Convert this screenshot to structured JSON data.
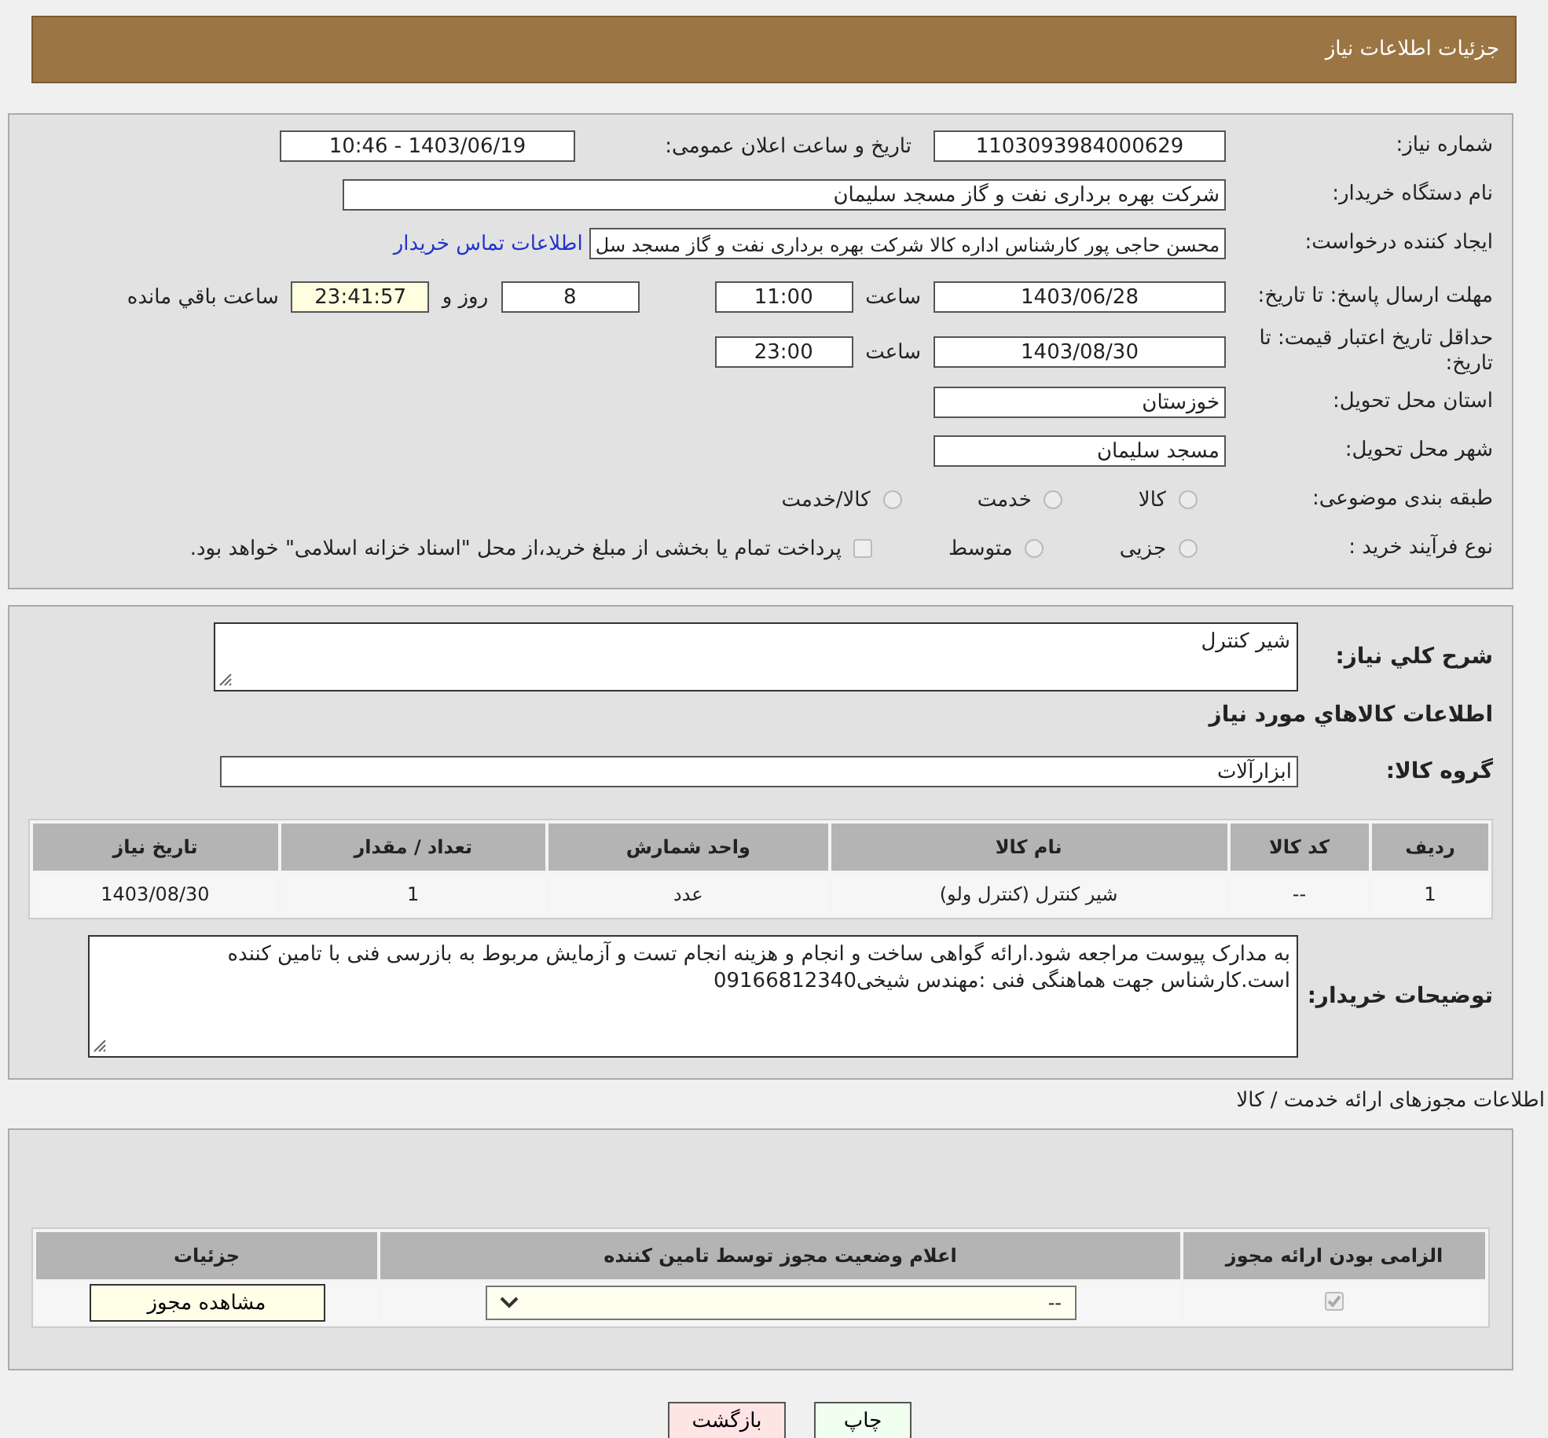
{
  "header": {
    "title": "جزئیات اطلاعات نیاز"
  },
  "need_number": {
    "label": "شماره نیاز:",
    "value": "1103093984000629"
  },
  "announce": {
    "label": "تاریخ و ساعت اعلان عمومی:",
    "value": "1403/06/19 - 10:46"
  },
  "buyer_org": {
    "label": "نام دستگاه خریدار:",
    "value": "شرکت بهره برداری نفت و گاز مسجد سلیمان"
  },
  "requester": {
    "label": "ایجاد کننده درخواست:",
    "value": "محسن حاجی پور کارشناس اداره کالا  شرکت بهره برداری نفت و گاز مسجد سل",
    "link": "اطلاعات تماس خریدار"
  },
  "reply_deadline": {
    "label": "مهلت ارسال پاسخ: تا تاریخ:",
    "date": "1403/06/28",
    "time_label": "ساعت",
    "time": "11:00",
    "days": "8",
    "days_label": "روز و",
    "remaining": "23:41:57",
    "remaining_label": "ساعت باقي مانده"
  },
  "price_validity": {
    "label": "حداقل تاریخ اعتبار قیمت: تا تاریخ:",
    "date": "1403/08/30",
    "time_label": "ساعت",
    "time": "23:00"
  },
  "province": {
    "label": "استان محل تحویل:",
    "value": "خوزستان"
  },
  "city": {
    "label": "شهر محل تحویل:",
    "value": "مسجد سلیمان"
  },
  "category": {
    "label": "طبقه بندی موضوعی:",
    "options": [
      {
        "label": "کالا",
        "selected": false
      },
      {
        "label": "خدمت",
        "selected": false
      },
      {
        "label": "کالا/خدمت",
        "selected": false
      }
    ]
  },
  "purchase_type": {
    "label": "نوع فرآیند خرید :",
    "options": [
      {
        "label": "جزیی",
        "selected": false
      },
      {
        "label": "متوسط",
        "selected": false
      }
    ],
    "payment_note": {
      "checked": false,
      "text": "پرداخت تمام یا بخشی از مبلغ خرید،از محل \"اسناد خزانه اسلامی\" خواهد بود."
    }
  },
  "description": {
    "label": "شرح کلي نياز:",
    "value": "شیر کنترل"
  },
  "goods_title": "اطلاعات کالاهاي مورد نياز",
  "goods_group": {
    "label": "گروه کالا:",
    "value": "ابزارآلات"
  },
  "goods_table": {
    "columns": [
      "ردیف",
      "کد کالا",
      "نام کالا",
      "واحد شمارش",
      "تعداد / مقدار",
      "تاریخ نیاز"
    ],
    "rows": [
      [
        "1",
        "--",
        "شیر کنترل (کنترل ولو)",
        "عدد",
        "1",
        "1403/08/30"
      ]
    ]
  },
  "buyer_notes": {
    "label": "توضیحات خریدار:",
    "value": "به مدارک پیوست مراجعه شود.ارائه گواهی ساخت و انجام و هزینه انجام تست و آزمایش مربوط به بازرسی فنی با تامین کننده است.کارشناس جهت هماهنگی فنی :مهندس شیخی09166812340"
  },
  "permits": {
    "title": "اطلاعات مجوزهای ارائه خدمت / کالا",
    "columns": [
      "الزامی بودن ارائه مجوز",
      "اعلام وضعیت مجوز توسط تامین کننده",
      "جزئیات"
    ],
    "rows": [
      {
        "required": true,
        "status": "--",
        "details": "مشاهده مجوز"
      }
    ]
  },
  "buttons": [
    {
      "label": "چاپ",
      "kind": "print"
    },
    {
      "label": "بازگشت",
      "kind": "back"
    }
  ]
}
